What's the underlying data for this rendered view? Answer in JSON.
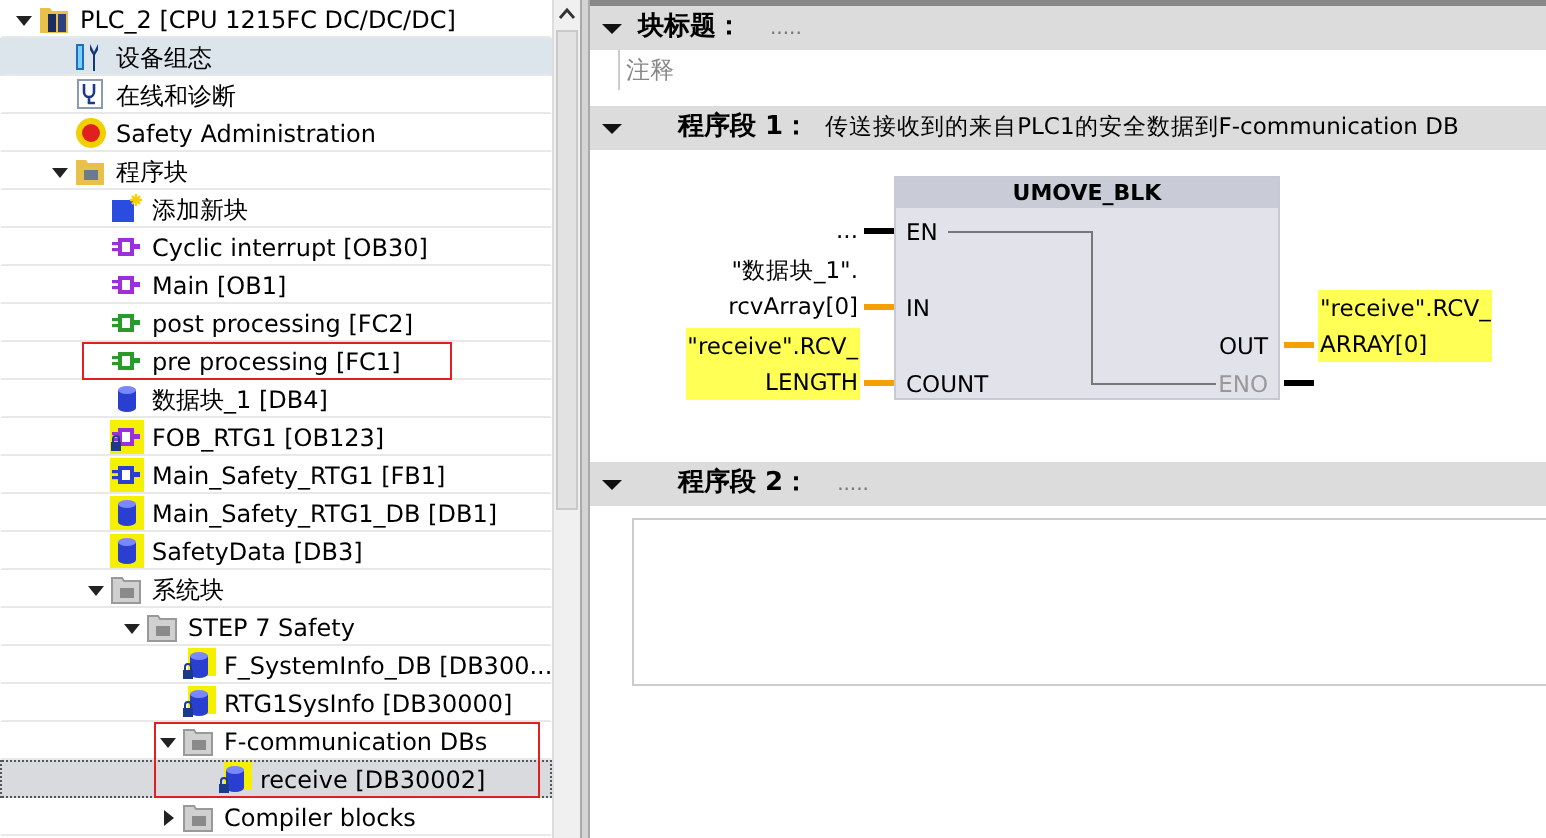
{
  "tree": [
    {
      "label": "PLC_2 [CPU 1215FC DC/DC/DC]",
      "kind": "plc",
      "expanded": true,
      "selected": false,
      "children": [
        {
          "label": "设备组态",
          "kind": "device",
          "selected": false,
          "hovered": true
        },
        {
          "label": "在线和诊断",
          "kind": "diagnostics",
          "selected": false
        },
        {
          "label": "Safety Administration",
          "kind": "safety",
          "selected": false
        },
        {
          "label": "程序块",
          "kind": "folder",
          "expanded": true,
          "selected": false,
          "children": [
            {
              "label": "添加新块",
              "kind": "add",
              "selected": false
            },
            {
              "label": "Cyclic interrupt [OB30]",
              "kind": "ob",
              "selected": false
            },
            {
              "label": "Main [OB1]",
              "kind": "ob",
              "selected": false
            },
            {
              "label": "post processing [FC2]",
              "kind": "fc",
              "selected": false
            },
            {
              "label": "pre processing [FC1]",
              "kind": "fc",
              "selected": false,
              "annotated": true
            },
            {
              "label": "数据块_1 [DB4]",
              "kind": "db",
              "selected": false
            },
            {
              "label": "FOB_RTG1 [OB123]",
              "kind": "f-ob",
              "selected": false
            },
            {
              "label": "Main_Safety_RTG1 [FB1]",
              "kind": "f-fb",
              "selected": false
            },
            {
              "label": "Main_Safety_RTG1_DB [DB1]",
              "kind": "f-db",
              "selected": false
            },
            {
              "label": "SafetyData [DB3]",
              "kind": "f-db",
              "selected": false
            },
            {
              "label": "系统块",
              "kind": "sysfolder",
              "expanded": true,
              "selected": false,
              "children": [
                {
                  "label": "STEP 7 Safety",
                  "kind": "sysfolder",
                  "expanded": true,
                  "selected": false,
                  "children": [
                    {
                      "label": "F_SystemInfo_DB [DB300...",
                      "kind": "f-db-lock",
                      "selected": false
                    },
                    {
                      "label": "RTG1SysInfo [DB30000]",
                      "kind": "f-db-lock",
                      "selected": false
                    },
                    {
                      "label": "F-communication DBs",
                      "kind": "sysfolder",
                      "expanded": true,
                      "selected": false,
                      "annotated": true,
                      "children": [
                        {
                          "label": "receive [DB30002]",
                          "kind": "f-db-lock",
                          "selected": true
                        }
                      ]
                    },
                    {
                      "label": "Compiler blocks",
                      "kind": "sysfolder",
                      "expanded": false,
                      "selected": false
                    }
                  ]
                }
              ]
            }
          ]
        }
      ]
    }
  ],
  "editor": [
    {
      "kind": "block_title",
      "label": "块标题：",
      "comment": ".....",
      "expanded": true,
      "note": "注释"
    },
    {
      "kind": "network",
      "label": "程序段 1：",
      "comment": "传送接收到的来自PLC1的安全数据到F-communication DB",
      "expanded": true,
      "block": {
        "title": "UMOVE_BLK",
        "inputs": [
          {
            "pin": "EN",
            "kind": "bool",
            "operand": [
              "..."
            ],
            "highlighted": false
          },
          {
            "pin": "IN",
            "kind": "data",
            "operand": [
              "\"数据块_1\".",
              "rcvArray[0]"
            ],
            "highlighted": false
          },
          {
            "pin": "COUNT",
            "kind": "data",
            "operand": [
              "\"receive\".RCV_",
              "LENGTH"
            ],
            "highlighted": true
          }
        ],
        "outputs": [
          {
            "pin": "OUT",
            "kind": "data",
            "operand": [
              "\"receive\".RCV_",
              "ARRAY[0]"
            ],
            "highlighted": true,
            "disabled": false
          },
          {
            "pin": "ENO",
            "kind": "bool",
            "disabled": true
          }
        ]
      }
    },
    {
      "kind": "network",
      "label": "程序段 2：",
      "comment": ".....",
      "expanded": true,
      "empty_rung": true
    }
  ]
}
